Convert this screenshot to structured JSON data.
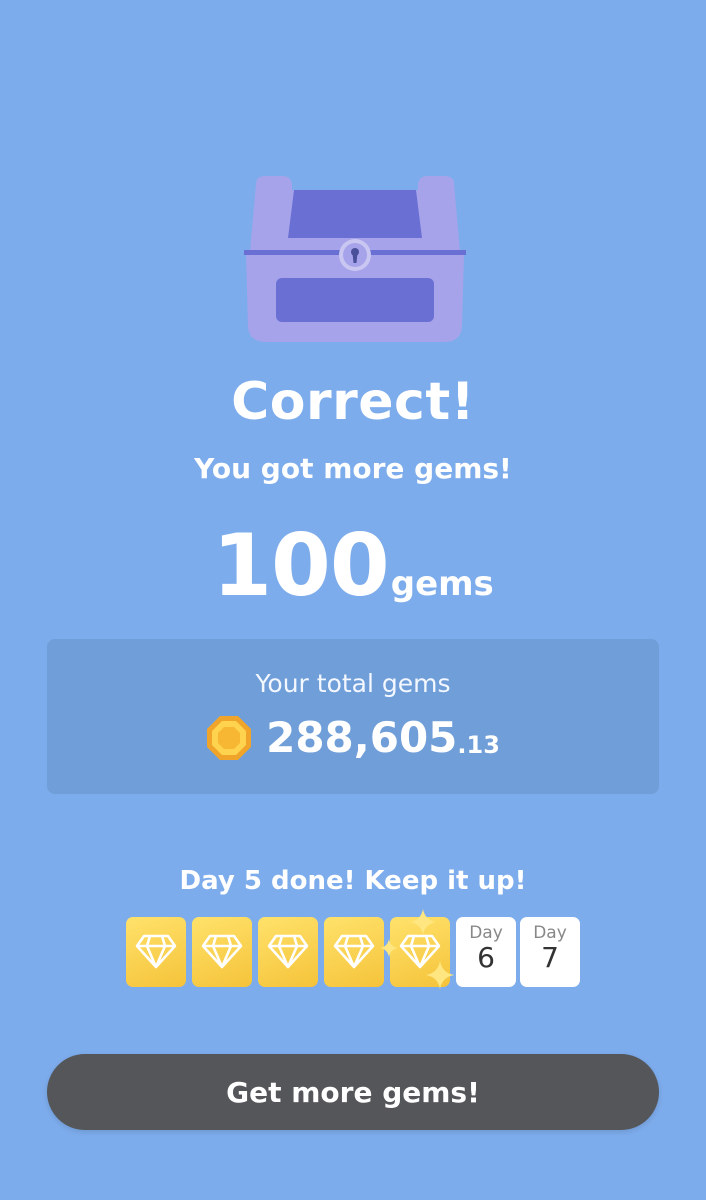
{
  "result": {
    "title": "Correct!",
    "subtitle": "You got more gems!",
    "reward_amount": "100",
    "reward_unit": "gems"
  },
  "total": {
    "label": "Your total gems",
    "value_int": "288,605",
    "value_dec": ".13"
  },
  "streak": {
    "message": "Day 5 done! Keep it up!",
    "completed_days": 5,
    "upcoming": [
      {
        "label": "Day",
        "number": "6"
      },
      {
        "label": "Day",
        "number": "7"
      }
    ]
  },
  "cta": {
    "label": "Get more gems!"
  },
  "colors": {
    "background": "#7dacec",
    "panel": "#6f9ed8",
    "chest": "#a7a3ea",
    "chest_dark": "#6a6fd4",
    "gold": "#f5c33a",
    "button": "#545659"
  },
  "icons": {
    "chest": "treasure-chest-icon",
    "coin": "gem-coin-icon",
    "diamond": "diamond-icon",
    "sparkle": "sparkle-icon"
  }
}
